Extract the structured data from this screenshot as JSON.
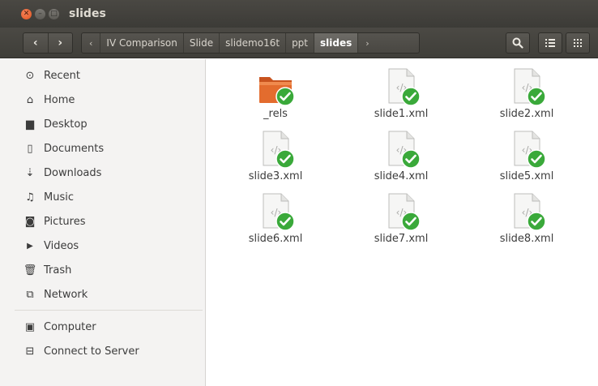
{
  "window": {
    "title": "slides",
    "close_glyph": "✕",
    "min_glyph": "–",
    "max_glyph": "□"
  },
  "toolbar": {
    "back_glyph": "‹",
    "forward_glyph": "›",
    "path_left_arrow": "‹",
    "path_right_arrow": "›",
    "breadcrumbs": [
      "IV Comparison",
      "Slide",
      "slidemo16t",
      "ppt",
      "slides"
    ],
    "search_icon": "search-icon",
    "list_view_icon": "list-view-icon",
    "grid_view_icon": "grid-view-icon"
  },
  "sidebar": {
    "items": [
      {
        "label": "Recent",
        "icon": "recent-icon",
        "glyph": "⊙"
      },
      {
        "label": "Home",
        "icon": "home-icon",
        "glyph": "⌂"
      },
      {
        "label": "Desktop",
        "icon": "desktop-folder-icon",
        "glyph": "▆"
      },
      {
        "label": "Documents",
        "icon": "document-icon",
        "glyph": "▯"
      },
      {
        "label": "Downloads",
        "icon": "download-icon",
        "glyph": "⇣"
      },
      {
        "label": "Music",
        "icon": "music-icon",
        "glyph": "♫"
      },
      {
        "label": "Pictures",
        "icon": "camera-icon",
        "glyph": "◙"
      },
      {
        "label": "Videos",
        "icon": "video-icon",
        "glyph": "▶"
      },
      {
        "label": "Trash",
        "icon": "trash-icon",
        "glyph": "🗑"
      },
      {
        "label": "Network",
        "icon": "network-icon",
        "glyph": "⧉"
      }
    ],
    "devices": [
      {
        "label": "Computer",
        "icon": "computer-icon",
        "glyph": "▣"
      },
      {
        "label": "Connect to Server",
        "icon": "server-icon",
        "glyph": "⊟"
      }
    ]
  },
  "files": [
    {
      "name": "_rels",
      "type": "folder"
    },
    {
      "name": "slide1.xml",
      "type": "xml"
    },
    {
      "name": "slide2.xml",
      "type": "xml"
    },
    {
      "name": "slide3.xml",
      "type": "xml"
    },
    {
      "name": "slide4.xml",
      "type": "xml"
    },
    {
      "name": "slide5.xml",
      "type": "xml"
    },
    {
      "name": "slide6.xml",
      "type": "xml"
    },
    {
      "name": "slide7.xml",
      "type": "xml"
    },
    {
      "name": "slide8.xml",
      "type": "xml"
    }
  ],
  "colors": {
    "titlebar": "#3c3b37",
    "close_button": "#e0541f",
    "folder": "#e36c2e",
    "sync_badge": "#3aa93a"
  }
}
